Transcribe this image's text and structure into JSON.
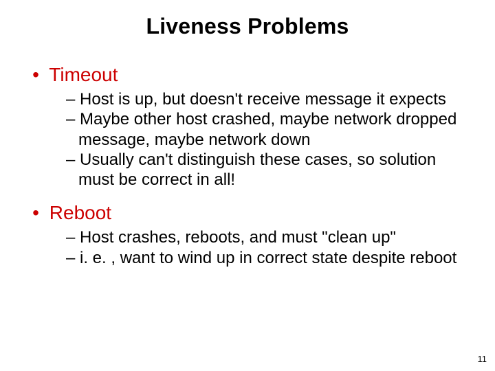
{
  "slide": {
    "title": "Liveness Problems",
    "bullets": [
      {
        "label": "Timeout",
        "subs": [
          "Host is up, but doesn't receive message it expects",
          "Maybe other host crashed, maybe network dropped message, maybe network down",
          "Usually can't distinguish these cases, so solution must be correct in all!"
        ]
      },
      {
        "label": "Reboot",
        "subs": [
          "Host crashes, reboots, and must \"clean up\"",
          "i. e. , want to wind up in correct state despite reboot"
        ]
      }
    ],
    "page_number": "11"
  }
}
